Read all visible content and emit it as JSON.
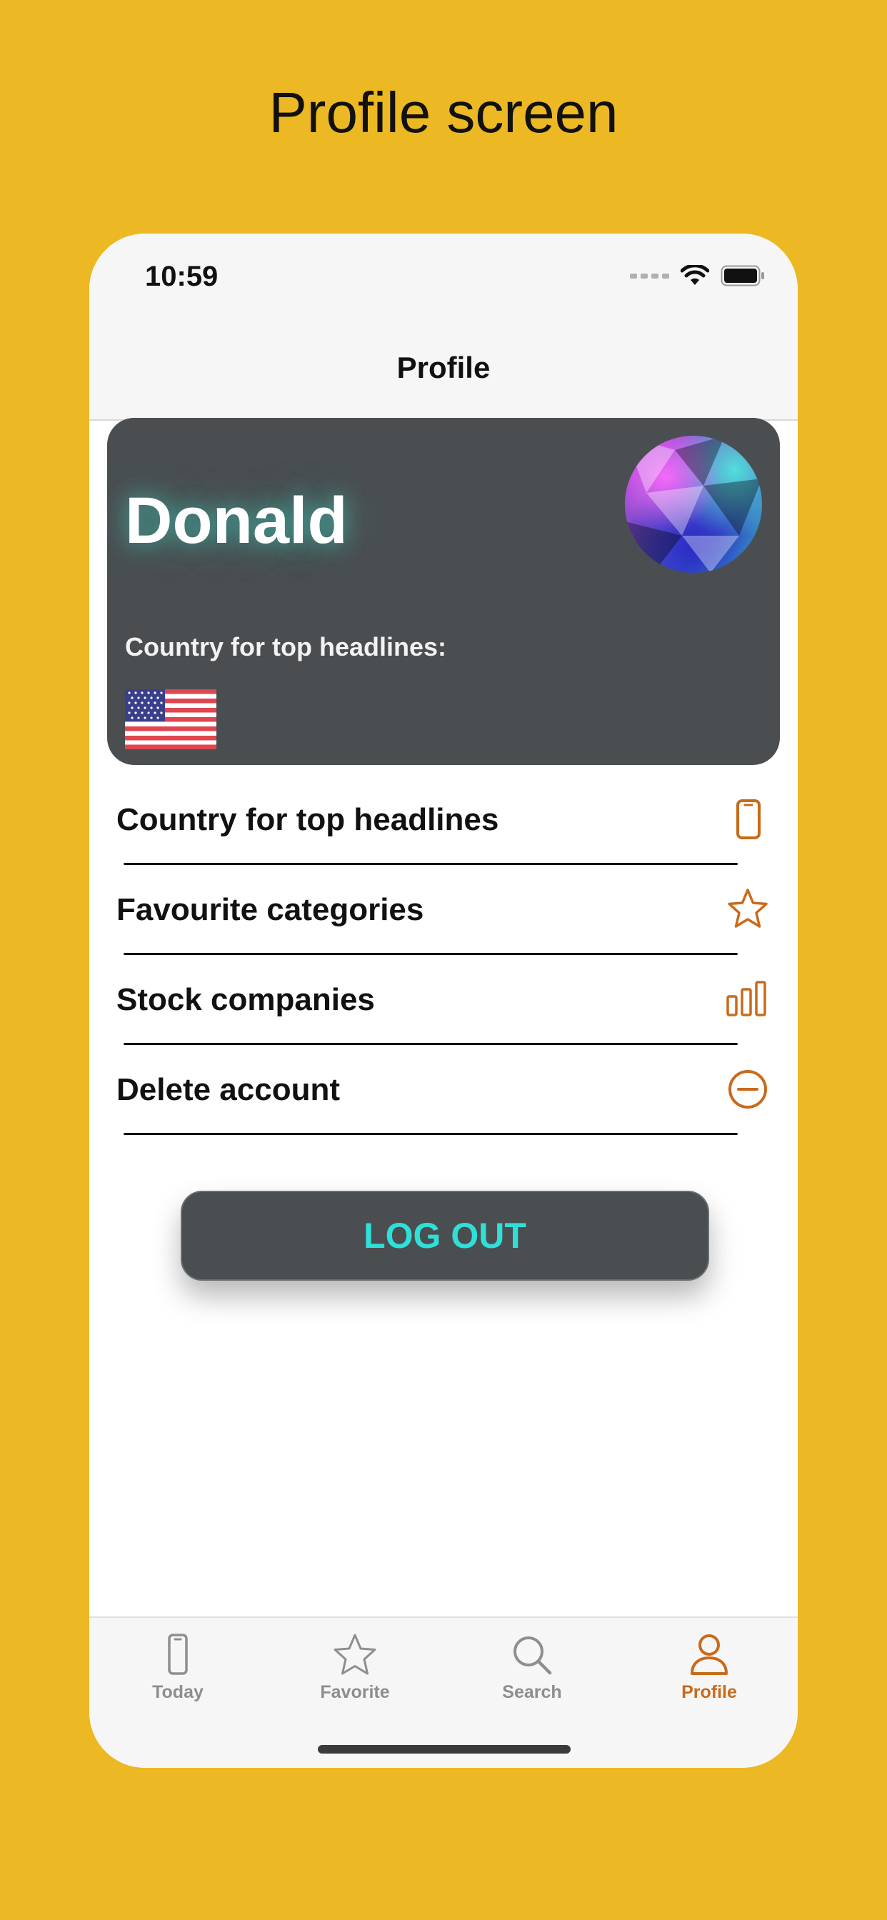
{
  "promo": {
    "title": "Profile screen"
  },
  "status_bar": {
    "time": "10:59",
    "icons": [
      "signal-dots",
      "wifi-icon",
      "battery-icon"
    ]
  },
  "nav": {
    "title": "Profile"
  },
  "profile_card": {
    "name": "Donald",
    "country_caption": "Country for top headlines:",
    "country_flag": "us-flag",
    "card_color": "#4A4E50",
    "name_glow_color": "#40E0D0"
  },
  "menu": {
    "items": [
      {
        "label": "Country for top headlines",
        "icon": "phone-icon"
      },
      {
        "label": "Favourite categories",
        "icon": "star-icon"
      },
      {
        "label": "Stock companies",
        "icon": "bar-chart-icon"
      },
      {
        "label": "Delete account",
        "icon": "minus-circle-icon"
      }
    ],
    "icon_color": "#C96A1A"
  },
  "logout": {
    "label": "LOG OUT",
    "text_color": "#2EE0D8"
  },
  "tabs": {
    "items": [
      {
        "label": "Today",
        "icon": "phone-icon",
        "active": false
      },
      {
        "label": "Favorite",
        "icon": "star-icon",
        "active": false
      },
      {
        "label": "Search",
        "icon": "search-icon",
        "active": false
      },
      {
        "label": "Profile",
        "icon": "person-icon",
        "active": true
      }
    ],
    "active_color": "#C96A1A",
    "inactive_color": "#8E8E8E"
  },
  "colors": {
    "background": "#ECB823"
  }
}
